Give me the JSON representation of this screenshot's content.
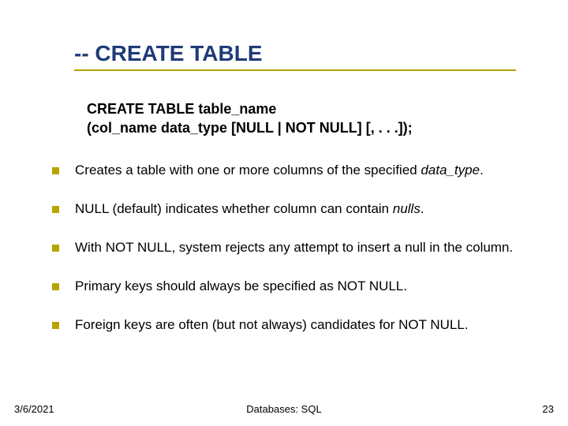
{
  "title": "-- CREATE TABLE",
  "syntax": {
    "line1": "CREATE TABLE table_name",
    "line2": "(col_name data_type [NULL | NOT NULL] [, . . .]);"
  },
  "bullets": [
    {
      "pre": "Creates a table with one or more columns of the specified ",
      "italic": "data_type",
      "post": "."
    },
    {
      "pre": "NULL (default) indicates whether column can contain ",
      "italic": "nulls",
      "post": "."
    },
    {
      "pre": "With NOT NULL, system rejects any attempt to insert a null in the column.",
      "italic": "",
      "post": ""
    },
    {
      "pre": "Primary keys should always be specified as NOT NULL.",
      "italic": "",
      "post": ""
    },
    {
      "pre": "Foreign keys are often (but not always) candidates for NOT NULL.",
      "italic": "",
      "post": ""
    }
  ],
  "footer": {
    "date": "3/6/2021",
    "center": "Databases: SQL",
    "page": "23"
  }
}
